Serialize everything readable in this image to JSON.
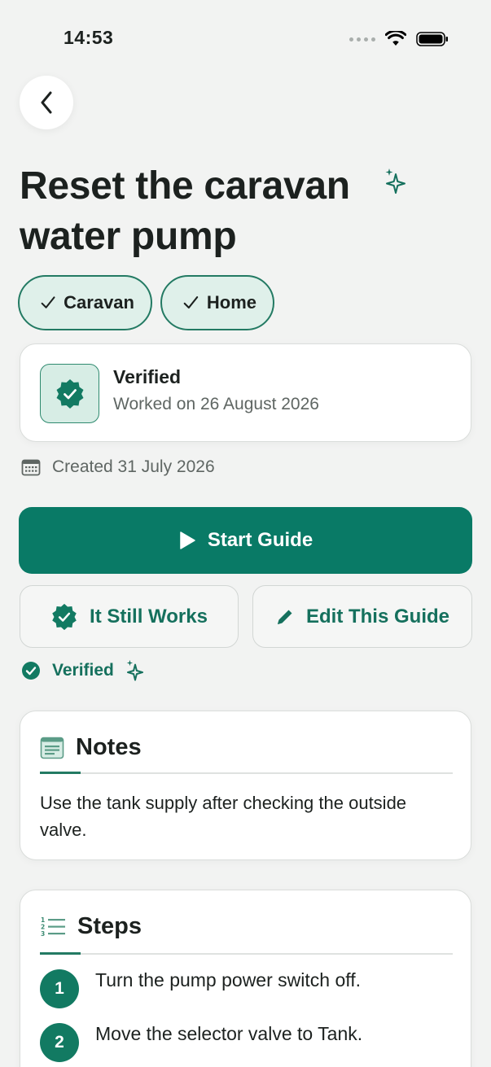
{
  "status_bar": {
    "time": "14:53",
    "icons": [
      "signal-dots-icon",
      "wifi-icon",
      "battery-icon"
    ]
  },
  "header": {
    "back_icon": "chevron-left-icon"
  },
  "guide": {
    "title": "Reset the caravan water pump",
    "title_icon": "sparkle-icon",
    "tags": [
      {
        "label": "Caravan",
        "icon": "check-icon"
      },
      {
        "label": "Home",
        "icon": "check-icon"
      }
    ]
  },
  "verified_card": {
    "icon": "verified-badge-icon",
    "title": "Verified",
    "subtitle": "Worked on 26 August 2026"
  },
  "created": {
    "icon": "calendar-icon",
    "text": "Created 31 July 2026"
  },
  "actions": {
    "start_label": "Start Guide",
    "start_icon": "play-icon",
    "still_works_label": "It Still Works",
    "still_works_icon": "verified-badge-icon",
    "edit_label": "Edit This Guide",
    "edit_icon": "pencil-icon"
  },
  "verified_status": {
    "label": "Verified",
    "icon": "check-circle-icon",
    "extra_icon": "sparkle-icon"
  },
  "notes": {
    "heading": "Notes",
    "icon": "notes-icon",
    "text": "Use the tank supply after checking the outside valve."
  },
  "steps": {
    "heading": "Steps",
    "icon": "numbered-list-icon",
    "items": [
      {
        "number": "1",
        "text": "Turn the pump power switch off."
      },
      {
        "number": "2",
        "text": "Move the selector valve to Tank."
      }
    ]
  },
  "colors": {
    "background": "#f2f3f2",
    "accent": "#097a66",
    "accent_dark": "#15705d",
    "tag_fill": "#dff0ea",
    "text": "#1c211f",
    "muted": "#5f6663"
  }
}
